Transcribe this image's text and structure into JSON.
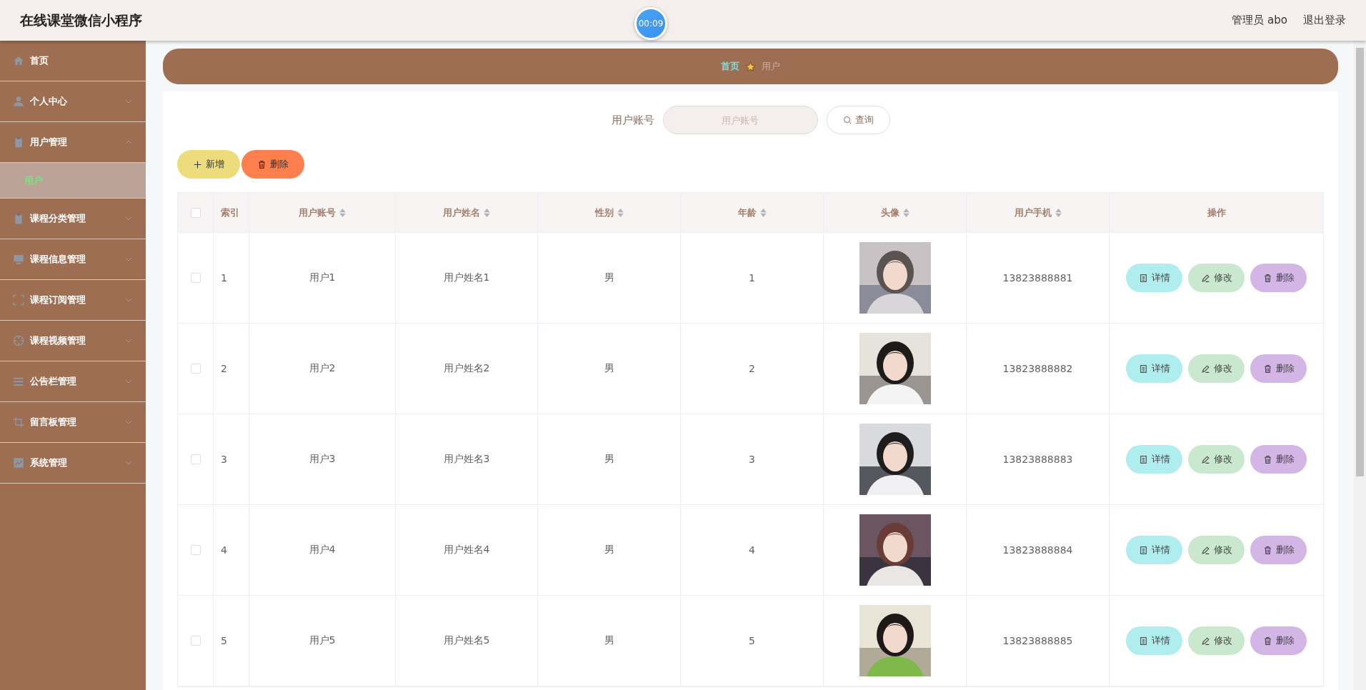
{
  "header": {
    "title": "在线课堂微信小程序",
    "timer": "00:09",
    "user": "管理员 abo",
    "logout": "退出登录"
  },
  "sidebar": {
    "items": [
      {
        "label": "首页"
      },
      {
        "label": "个人中心",
        "expanded": false
      },
      {
        "label": "用户管理",
        "expanded": true,
        "children": [
          {
            "label": "用户",
            "selected": true
          }
        ]
      },
      {
        "label": "课程分类管理",
        "expanded": false
      },
      {
        "label": "课程信息管理",
        "expanded": false
      },
      {
        "label": "课程订阅管理",
        "expanded": false
      },
      {
        "label": "课程视频管理",
        "expanded": false
      },
      {
        "label": "公告栏管理",
        "expanded": false
      },
      {
        "label": "留言板管理",
        "expanded": false
      },
      {
        "label": "系统管理",
        "expanded": false
      }
    ]
  },
  "breadcrumb": [
    "首页",
    "用户"
  ],
  "search": {
    "label": "用户账号",
    "placeholder": "用户账号",
    "button": "查询"
  },
  "actions": [
    {
      "kind": "add",
      "label": "新增"
    },
    {
      "kind": "delete",
      "label": "删除"
    }
  ],
  "table": {
    "select_all": {
      "checked": false
    },
    "columns": [
      {
        "label": "索引",
        "sortable": false
      },
      {
        "label": "用户账号",
        "sortable": true
      },
      {
        "label": "用户姓名",
        "sortable": true
      },
      {
        "label": "性别",
        "sortable": true
      },
      {
        "label": "年龄",
        "sortable": true
      },
      {
        "label": "头像",
        "sortable": true
      },
      {
        "label": "用户手机",
        "sortable": true
      },
      {
        "label": "操作",
        "sortable": false
      }
    ],
    "rows": [
      {
        "checked": false,
        "index": "1",
        "account": "用户1",
        "name": "用户姓名1",
        "gender": "男",
        "age": "1",
        "phone": "13823888881",
        "buttons": [
          {
            "kind": "detail",
            "label": "详情"
          },
          {
            "kind": "edit",
            "label": "修改"
          },
          {
            "kind": "delete",
            "label": "删除"
          }
        ]
      },
      {
        "checked": false,
        "index": "2",
        "account": "用户2",
        "name": "用户姓名2",
        "gender": "男",
        "age": "2",
        "phone": "13823888882",
        "buttons": [
          {
            "kind": "detail",
            "label": "详情"
          },
          {
            "kind": "edit",
            "label": "修改"
          },
          {
            "kind": "delete",
            "label": "删除"
          }
        ]
      },
      {
        "checked": false,
        "index": "3",
        "account": "用户3",
        "name": "用户姓名3",
        "gender": "男",
        "age": "3",
        "phone": "13823888883",
        "buttons": [
          {
            "kind": "detail",
            "label": "详情"
          },
          {
            "kind": "edit",
            "label": "修改"
          },
          {
            "kind": "delete",
            "label": "删除"
          }
        ]
      },
      {
        "checked": false,
        "index": "4",
        "account": "用户4",
        "name": "用户姓名4",
        "gender": "男",
        "age": "4",
        "phone": "13823888884",
        "buttons": [
          {
            "kind": "detail",
            "label": "详情"
          },
          {
            "kind": "edit",
            "label": "修改"
          },
          {
            "kind": "delete",
            "label": "删除"
          }
        ]
      },
      {
        "checked": false,
        "index": "5",
        "account": "用户5",
        "name": "用户姓名5",
        "gender": "男",
        "age": "5",
        "phone": "13823888885",
        "buttons": [
          {
            "kind": "detail",
            "label": "详情"
          },
          {
            "kind": "edit",
            "label": "修改"
          },
          {
            "kind": "delete",
            "label": "删除"
          }
        ]
      }
    ]
  }
}
